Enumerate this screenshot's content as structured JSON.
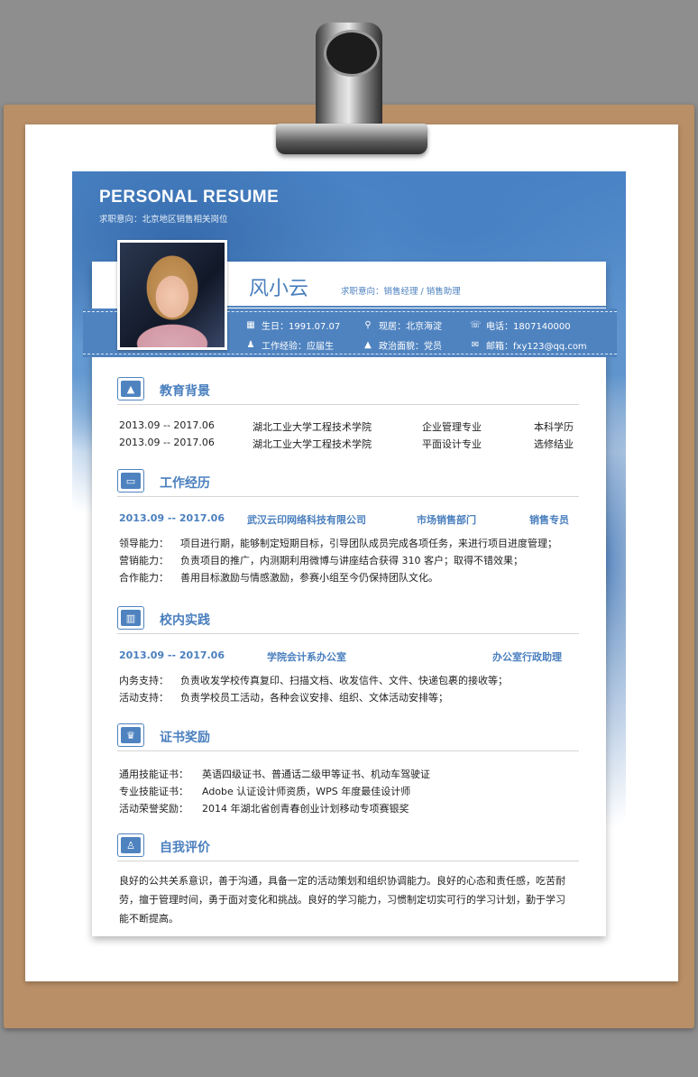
{
  "header": {
    "title": "PERSONAL RESUME",
    "subtitle": "求职意向：北京地区销售相关岗位"
  },
  "profile": {
    "name": "风小云",
    "intent": "求职意向：销售经理 / 销售助理",
    "info": [
      {
        "icon": "calendar-icon",
        "glyph": "▦",
        "text": "生日：1991.07.07"
      },
      {
        "icon": "location-icon",
        "glyph": "⚲",
        "text": "现居：北京海淀"
      },
      {
        "icon": "phone-icon",
        "glyph": "☏",
        "text": "电话：1807140000"
      },
      {
        "icon": "user-icon",
        "glyph": "♟",
        "text": "工作经验：应届生"
      },
      {
        "icon": "graduation-cap-icon",
        "glyph": "▲",
        "text": "政治面貌：党员"
      },
      {
        "icon": "mail-icon",
        "glyph": "✉",
        "text": "邮箱：fxy123@qq.com"
      }
    ]
  },
  "sections": {
    "education": {
      "title": "教育背景",
      "icon": "graduation-cap-icon",
      "rows": [
        [
          "2013.09 -- 2017.06",
          "湖北工业大学工程技术学院",
          "企业管理专业",
          "本科学历"
        ],
        [
          "2013.09 -- 2017.06",
          "湖北工业大学工程技术学院",
          "平面设计专业",
          "选修结业"
        ]
      ]
    },
    "work": {
      "title": "工作经历",
      "icon": "id-card-icon",
      "header": [
        "2013.09 -- 2017.06",
        "武汉云印网络科技有限公司",
        "市场销售部门",
        "销售专员"
      ],
      "lines": [
        {
          "label": "领导能力：",
          "text": "项目进行期，能够制定短期目标，引导团队成员完成各项任务，来进行项目进度管理；"
        },
        {
          "label": "营销能力：",
          "text": "负责项目的推广，内测期利用微博与讲座结合获得 310 客户；取得不错效果；"
        },
        {
          "label": "合作能力：",
          "text": "善用目标激励与情感激励，参赛小组至今仍保持团队文化。"
        }
      ]
    },
    "campus": {
      "title": "校内实践",
      "icon": "chart-icon",
      "header": [
        "2013.09 -- 2017.06",
        "学院会计系办公室",
        "办公室行政助理"
      ],
      "lines": [
        {
          "label": "内务支持：",
          "text": "负责收发学校传真复印、扫描文档、收发信件、文件、快递包裹的接收等；"
        },
        {
          "label": "活动支持：",
          "text": "负责学校员工活动，各种会议安排、组织、文体活动安排等；"
        }
      ]
    },
    "awards": {
      "title": "证书奖励",
      "icon": "trophy-icon",
      "lines": [
        {
          "label": "通用技能证书：",
          "text": "英语四级证书、普通话二级甲等证书、机动车驾驶证"
        },
        {
          "label": "专业技能证书：",
          "text": "Adobe 认证设计师资质，WPS 年度最佳设计师"
        },
        {
          "label": "活动荣誉奖励：",
          "text": "2014 年湖北省创青春创业计划移动专项赛银奖"
        }
      ]
    },
    "self": {
      "title": "自我评价",
      "icon": "person-icon",
      "text": "良好的公共关系意识，善于沟通，具备一定的活动策划和组织协调能力。良好的心态和责任感，吃苦耐劳，擅于管理时间，勇于面对变化和挑战。良好的学习能力，习惯制定切实可行的学习计划，勤于学习能不断提高。"
    }
  },
  "colors": {
    "accent": "#4a7fbe",
    "ribbon": "#4f83c0",
    "board": "#b88f67"
  }
}
